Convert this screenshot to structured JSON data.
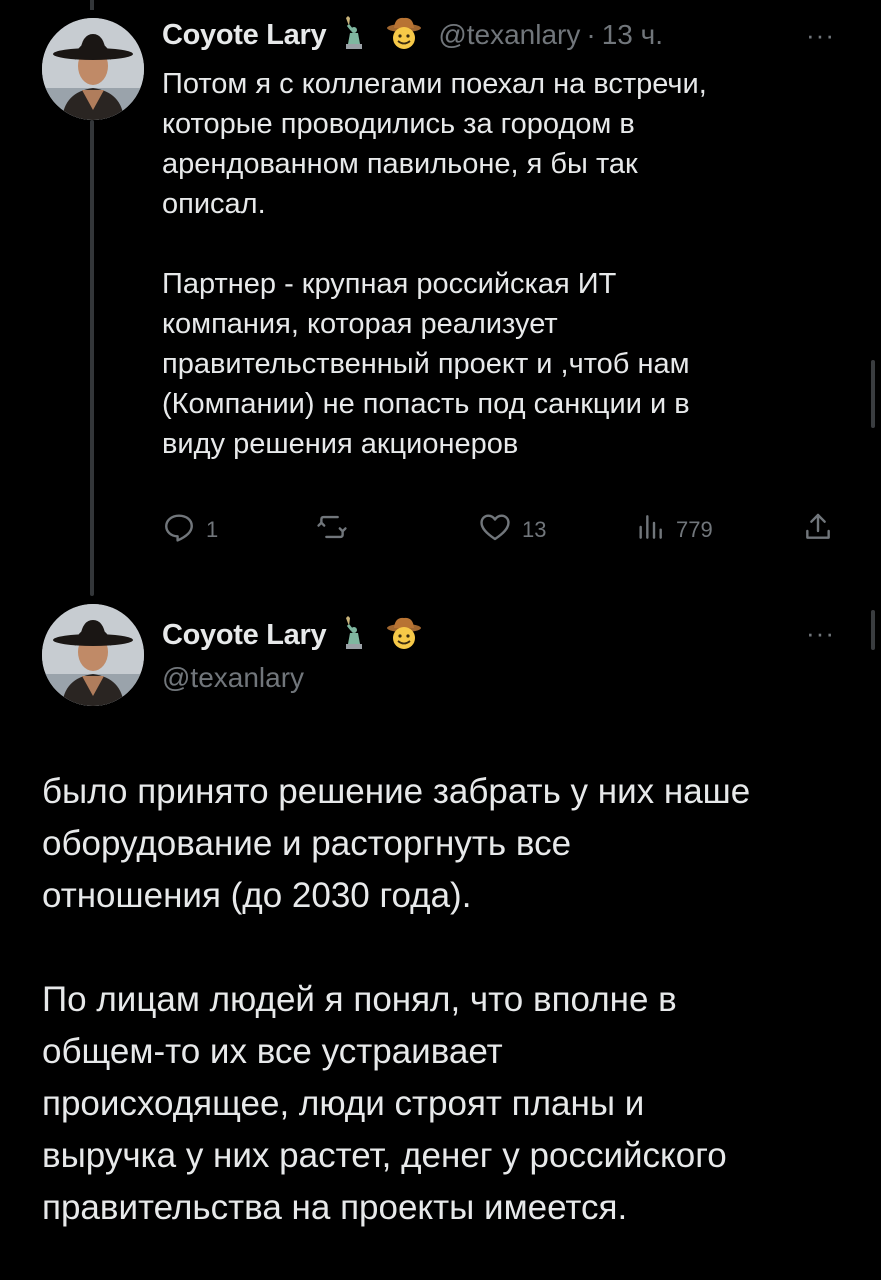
{
  "tweet1": {
    "display_name": "Coyote Lary",
    "handle": "@texanlary",
    "separator": "·",
    "time": "13 ч.",
    "more": "···",
    "text": "Потом я с коллегами поехал на встречи,\nкоторые проводились за городом в\nарендованном павильоне, я бы так\nописал.\n\nПартнер - крупная российская ИТ\nкомпания, которая реализует\nправительственный проект и ,чтоб нам\n(Компании) не попасть под санкции и в\nвиду решения акционеров",
    "actions": {
      "replies": "1",
      "retweets": "",
      "likes": "13",
      "views": "779"
    }
  },
  "tweet2": {
    "display_name": "Coyote Lary",
    "handle": "@texanlary",
    "more": "···",
    "text": "было принято решение забрать у них наше\nоборудование и расторгнуть все\nотношения (до 2030 года).\n\nПо лицам людей я понял, что вполне в\nобщем-то их все устраивает\nпроисходящее, люди строят планы и\nвыручка у них растет, денег у российского\nправительства на проекты имеется."
  },
  "icons": [
    "statue-of-liberty-icon",
    "cowboy-emoji-icon",
    "reply-icon",
    "retweet-icon",
    "like-icon",
    "views-icon",
    "share-icon"
  ],
  "colors": {
    "background": "#000000",
    "text": "#e7e9ea",
    "secondary": "#71767b",
    "thread_line": "#333639"
  }
}
